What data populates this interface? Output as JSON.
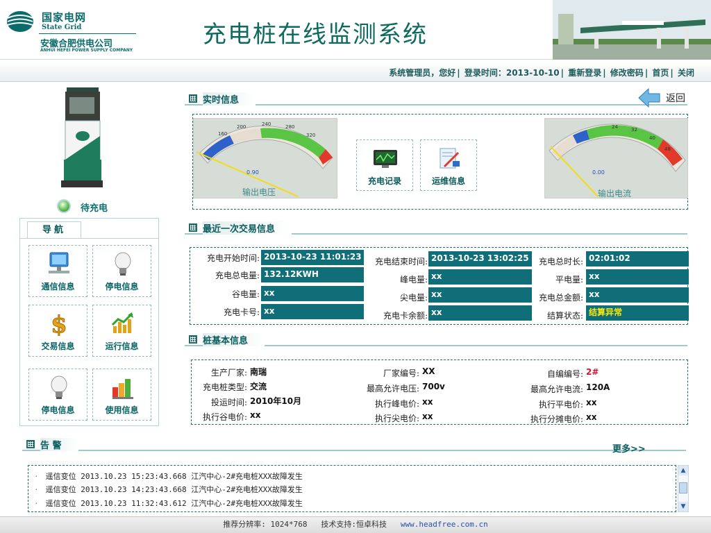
{
  "header": {
    "logo_cn": "国家电网",
    "logo_en": "State Grid",
    "company": "安徽合肥供电公司",
    "company_en": "ANHUI HEFEI POWER SUPPLY COMPANY",
    "title": "充电桩在线监测系统"
  },
  "topbar": {
    "greeting": "系统管理员，您好",
    "login_label": "登录时间：",
    "login_time": "2013-10-10",
    "relogin": "重新登录",
    "change_pwd": "修改密码",
    "home": "首页",
    "close": "关闭"
  },
  "status": {
    "label": "待充电",
    "color": "#64c050"
  },
  "nav": {
    "title": "导航",
    "items": [
      {
        "label": "通信信息",
        "icon": "computer-icon"
      },
      {
        "label": "停电信息",
        "icon": "lightbulb-icon"
      },
      {
        "label": "交易信息",
        "icon": "dollar-icon"
      },
      {
        "label": "运行信息",
        "icon": "chart-icon"
      },
      {
        "label": "停电信息",
        "icon": "lightbulb-icon"
      },
      {
        "label": "使用信息",
        "icon": "bar-chart-icon"
      }
    ]
  },
  "realtime": {
    "title": "实时信息",
    "back": "返回",
    "gauge_voltage": {
      "label": "输出电压",
      "readout": "0.90",
      "ticks": [
        "160",
        "200",
        "240",
        "280",
        "320"
      ]
    },
    "gauge_current": {
      "label": "输出电流",
      "readout": "0.00",
      "ticks": [
        "24",
        "32",
        "40",
        "48"
      ]
    },
    "quick": [
      {
        "label": "充电记录",
        "icon": "monitor-icon"
      },
      {
        "label": "运维信息",
        "icon": "tools-icon"
      }
    ]
  },
  "transaction": {
    "title": "最近一次交易信息",
    "rows": [
      [
        {
          "label": "充电开始时间:",
          "value": "2013-10-23 11:01:23"
        },
        {
          "label": "充电结束时间:",
          "value": "2013-10-23 13:02:25"
        },
        {
          "label": "充电总时长:",
          "value": "02:01:02"
        }
      ],
      [
        {
          "label": "充电总电量:",
          "value": "132.12KWH"
        },
        {
          "label": "峰电量:",
          "value": "xx"
        },
        {
          "label": "平电量:",
          "value": "xx"
        }
      ],
      [
        {
          "label": "谷电量:",
          "value": "xx"
        },
        {
          "label": "尖电量:",
          "value": "xx"
        },
        {
          "label": "充电总金额:",
          "value": "xx"
        }
      ],
      [
        {
          "label": "充电卡号:",
          "value": "xx"
        },
        {
          "label": "充电卡余额:",
          "value": "xx"
        },
        {
          "label": "结算状态:",
          "value": "结算异常"
        }
      ]
    ]
  },
  "basic": {
    "title": "桩基本信息",
    "rows": [
      [
        {
          "label": "生产厂家:",
          "value": "南瑞"
        },
        {
          "label": "厂家编号:",
          "value": "XX"
        },
        {
          "label": "自编编号:",
          "value": "2#"
        }
      ],
      [
        {
          "label": "充电桩类型:",
          "value": "交流"
        },
        {
          "label": "最高允许电压:",
          "value": "700v"
        },
        {
          "label": "最高允许电流:",
          "value": "120A"
        }
      ],
      [
        {
          "label": "投运时间:",
          "value": "2010年10月"
        },
        {
          "label": "执行峰电价:",
          "value": "xx"
        },
        {
          "label": "执行平电价:",
          "value": "xx"
        }
      ],
      [
        {
          "label": "执行谷电价:",
          "value": "xx"
        },
        {
          "label": "执行尖电价:",
          "value": "xx"
        },
        {
          "label": "执行分摊电价:",
          "value": "xx"
        }
      ]
    ]
  },
  "alarm": {
    "title": "告 警",
    "more": "更多>>",
    "items": [
      "遥信变位 2013.10.23 15:23:43.668 江汽中心-2#充电桩XXX故障发生",
      "遥信变位 2013.10.23 14:23:43.668 江汽中心-2#充电桩XXX故障发生",
      "遥信变位 2013.10.23 11:32:43.612 江汽中心-2#充电桩XXX故障发生"
    ]
  },
  "footer": {
    "resolution": "推荐分辨率: 1024*768",
    "support": "技术支持:恒卓科技",
    "url": "www.headfree.com.cn"
  },
  "colors": {
    "accent": "#0f6e78",
    "title": "#0d6a5e",
    "warn": "#f6e90e",
    "red": "#e0102a"
  }
}
